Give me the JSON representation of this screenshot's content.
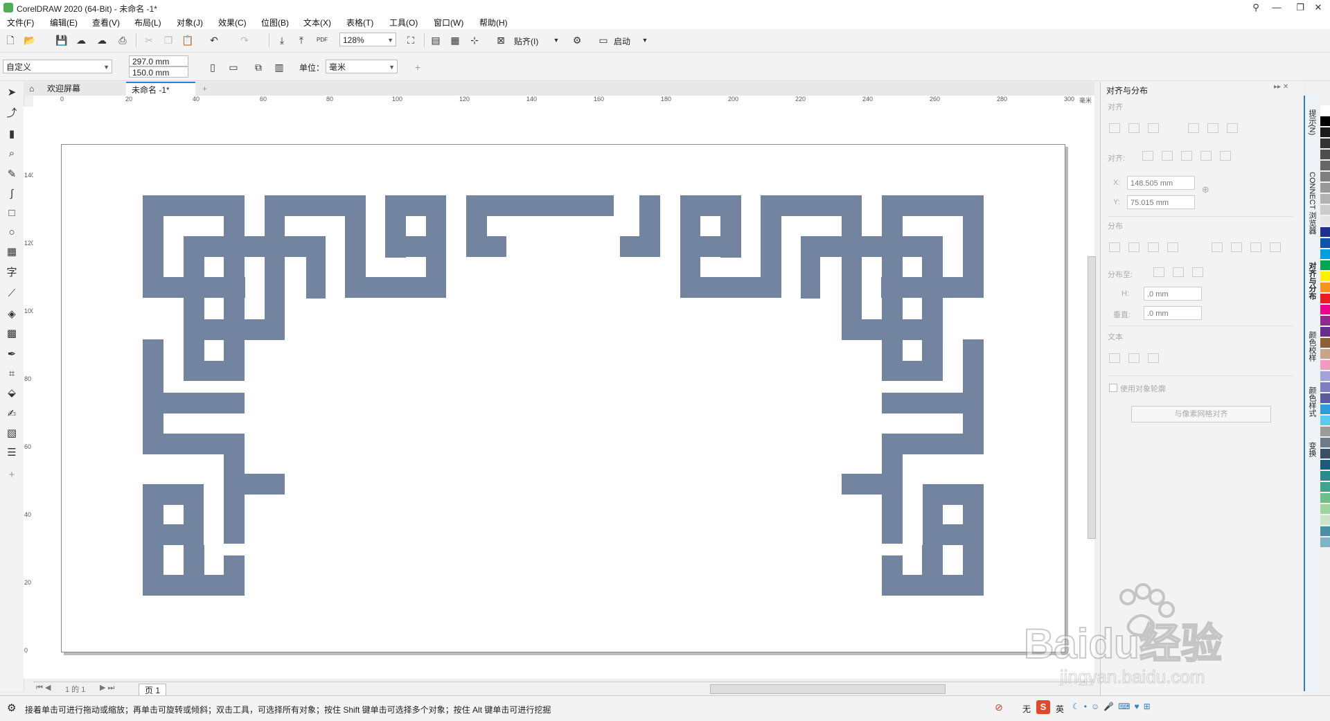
{
  "app": {
    "title": "CorelDRAW 2020 (64-Bit) - 未命名 -1*",
    "window_buttons": [
      "—",
      "❐",
      "✕"
    ]
  },
  "menu": [
    "文件(F)",
    "编辑(E)",
    "查看(V)",
    "布局(L)",
    "对象(J)",
    "效果(C)",
    "位图(B)",
    "文本(X)",
    "表格(T)",
    "工具(O)",
    "窗口(W)",
    "帮助(H)"
  ],
  "toolbar": {
    "zoom": "128%",
    "snap_label": "贴齐(I)",
    "launch_label": "启动",
    "pdf_label": "PDF"
  },
  "property_bar": {
    "preset": "自定义",
    "width": "297.0 mm",
    "height": "150.0 mm",
    "unit_label": "单位：",
    "unit_value": "毫米"
  },
  "tabs": {
    "welcome": "欢迎屏幕",
    "document": "未命名 -1*"
  },
  "ruler": {
    "h_ticks": [
      "0",
      "20",
      "40",
      "60",
      "80",
      "100",
      "120",
      "140",
      "160",
      "180",
      "200",
      "220",
      "240",
      "260",
      "280",
      "300"
    ],
    "h_unit": "毫米",
    "v_ticks": [
      "140",
      "120",
      "100",
      "80",
      "60",
      "40",
      "20",
      "0"
    ]
  },
  "pagebar": {
    "page_info": "1 的 1",
    "page_tab": "页 1"
  },
  "docker": {
    "title": "对齐与分布",
    "align_label": "对齐",
    "align_to_label": "对齐:",
    "x_label": "X:",
    "x_value": "148.505 mm",
    "y_label": "Y:",
    "y_value": "75.015 mm",
    "distribute_label": "分布",
    "distribute_to_label": "分布至:",
    "h_label": "H:",
    "h_value": ".0 mm",
    "v_label": "垂直:",
    "v_value": ".0 mm",
    "text_label": "文本",
    "use_outline_label": "使用对象轮廓",
    "grid_button": "与像素网格对齐"
  },
  "side_tabs": [
    "提示(N)",
    "CONNECT 浏览器",
    "对齐与分布",
    "颜色校样",
    "颜色样式",
    "变换"
  ],
  "status": {
    "message": "接着单击可进行拖动或缩放；再单击可旋转或倾斜；双击工具，可选择所有对象；按住 Shift 键单击可选择多个对象；按住 Alt 键单击可进行挖掘",
    "fill_label": "无",
    "ime_label": "英"
  },
  "watermark": {
    "text": "Baidu经验",
    "sub": "jingyan.baidu.com"
  },
  "colors": {
    "pattern": "#7284a0",
    "accent": "#2e7fc8",
    "palette": [
      "#ffffff",
      "#000000",
      "#1a1a1a",
      "#333333",
      "#4d4d4d",
      "#666666",
      "#808080",
      "#999999",
      "#b3b3b3",
      "#cccccc",
      "#e6e6e6",
      "#1f2f8f",
      "#0d55a8",
      "#00a0e0",
      "#00a651",
      "#fff200",
      "#f7941d",
      "#ed1c24",
      "#ec008c",
      "#92278f",
      "#662d91",
      "#8b5e3c",
      "#c7a58a",
      "#f49ac1",
      "#a3a3d6",
      "#7f7fbf",
      "#5a5a9c",
      "#2d9cdb",
      "#56ccf2",
      "#9b9b9b",
      "#6c7a89",
      "#3a4f63",
      "#1d5a7a",
      "#2b8a8a",
      "#3ea58a",
      "#6cbf8a",
      "#9fd39f",
      "#c9e4c9",
      "#4a90a4",
      "#7fb3c4"
    ]
  }
}
